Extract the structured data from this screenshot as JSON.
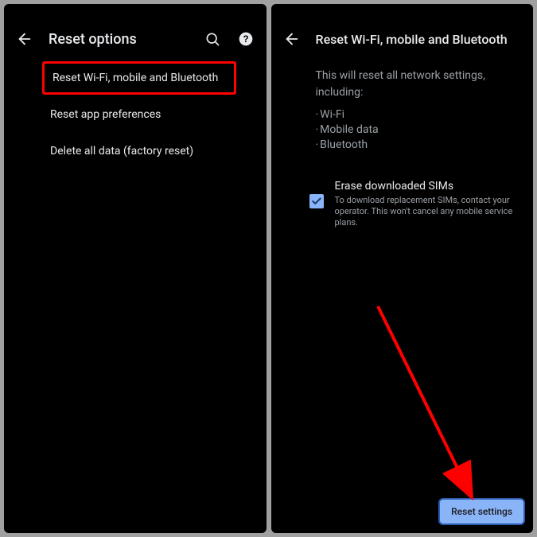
{
  "left": {
    "title": "Reset options",
    "items": {
      "highlighted": "Reset Wi-Fi, mobile and Bluetooth",
      "item2": "Reset app preferences",
      "item3": "Delete all data (factory reset)"
    }
  },
  "right": {
    "title": "Reset Wi-Fi, mobile and Bluetooth",
    "intro": "This will reset all network settings, including:",
    "bullets": {
      "b1": "Wi-Fi",
      "b2": "Mobile data",
      "b3": "Bluetooth"
    },
    "checkbox": {
      "title": "Erase downloaded SIMs",
      "subtitle": "To download replacement SIMs, contact your operator. This won't cancel any mobile service plans."
    },
    "cta": "Reset settings"
  },
  "colors": {
    "accent": "#8ab4f8",
    "highlight": "#ff0000"
  }
}
